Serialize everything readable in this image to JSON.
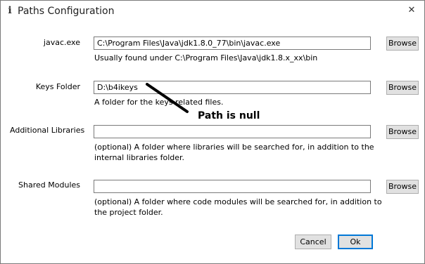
{
  "window": {
    "title": "Paths Configuration",
    "title_icon_glyph": "i",
    "icon": "info-icon",
    "close_glyph": "✕"
  },
  "fields": {
    "javac": {
      "label": "javac.exe",
      "value": "C:\\Program Files\\Java\\jdk1.8.0_77\\bin\\javac.exe",
      "hint": "Usually found under C:\\Program Files\\Java\\jdk1.8.x_xx\\bin",
      "browse_label": "Browse"
    },
    "keys_folder": {
      "label": "Keys Folder",
      "value": "D:\\b4ikeys",
      "hint": "A folder for the keys related files.",
      "browse_label": "Browse"
    },
    "additional_libraries": {
      "label": "Additional Libraries",
      "value": "",
      "hint_line1": "(optional) A folder where libraries will be searched for, in addition to the",
      "hint_line2": "internal libraries folder.",
      "browse_label": "Browse"
    },
    "shared_modules": {
      "label": "Shared Modules",
      "value": "",
      "hint_line1": "(optional) A folder where code modules will be searched for, in addition to",
      "hint_line2": "the project folder.",
      "browse_label": "Browse"
    }
  },
  "buttons": {
    "cancel_label": "Cancel",
    "ok_label": "Ok"
  },
  "annotation": {
    "text": "Path is null"
  },
  "colors": {
    "ok_focus_border": "#0078d7",
    "button_face": "#e1e1e1"
  }
}
